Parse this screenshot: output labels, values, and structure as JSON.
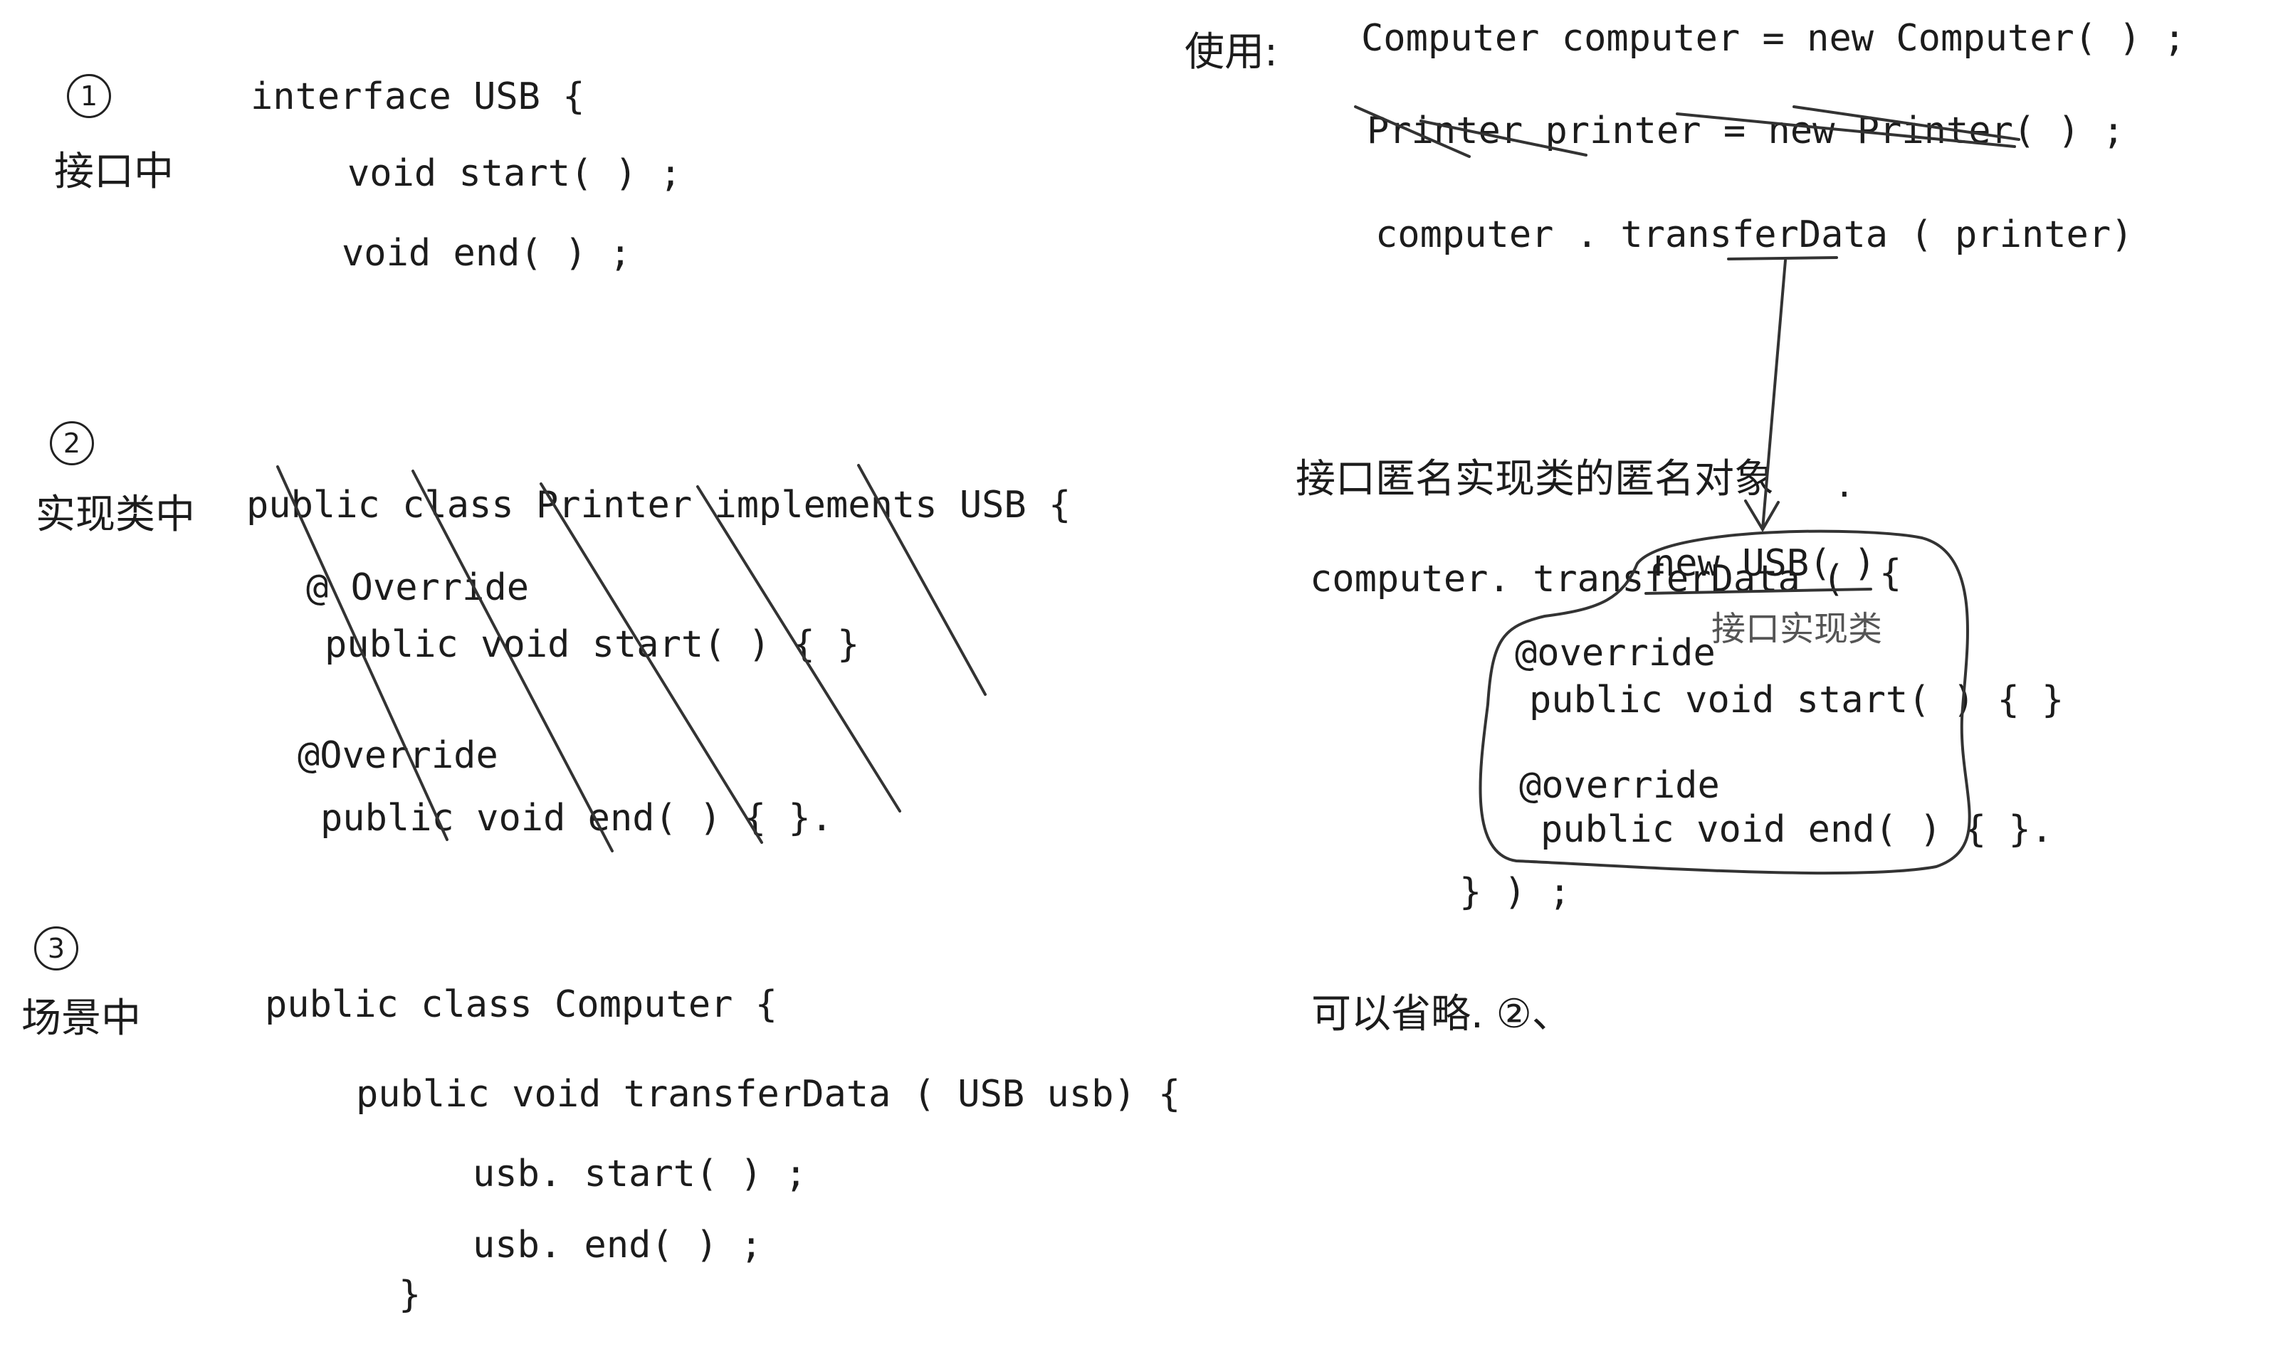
{
  "section1": {
    "number": "1",
    "label": "接口中",
    "lines": [
      "interface  USB  {",
      "void  start( ) ;",
      "void  end( ) ;"
    ]
  },
  "section2": {
    "number": "2",
    "label": "实现类中",
    "lines": [
      "public  class  Printer  implements  USB {",
      "@ Override",
      "public  void  start(  ) {    }",
      "@Override",
      "public  void  end(  )  {  }."
    ]
  },
  "section3": {
    "number": "3",
    "label": "场景中",
    "lines": [
      "public  class  Computer  {",
      "public  void  transferData ( USB usb) {",
      "usb. start( ) ;",
      "usb. end( ) ;",
      "}"
    ]
  },
  "usage": {
    "label": "使用:",
    "line1": "Computer  computer  =  new  Computer( ) ;",
    "line2": "Printer  printer  =  new  Printer( ) ;",
    "line3": "computer . transferData ( printer)"
  },
  "anonymous": {
    "heading": "接口匿名实现类的匿名对象",
    "dot": ".",
    "call": "computer. transferData (",
    "new_usb": "new  USB( )",
    "brace_open": "{",
    "impl_note": "接口实现类",
    "override1": "@override",
    "start_line": "public void start( )  { }",
    "override2": "@override",
    "end_line": "public void end( )   { }.",
    "closing": "} ) ;",
    "omit_note": "可以省略. ②、"
  }
}
